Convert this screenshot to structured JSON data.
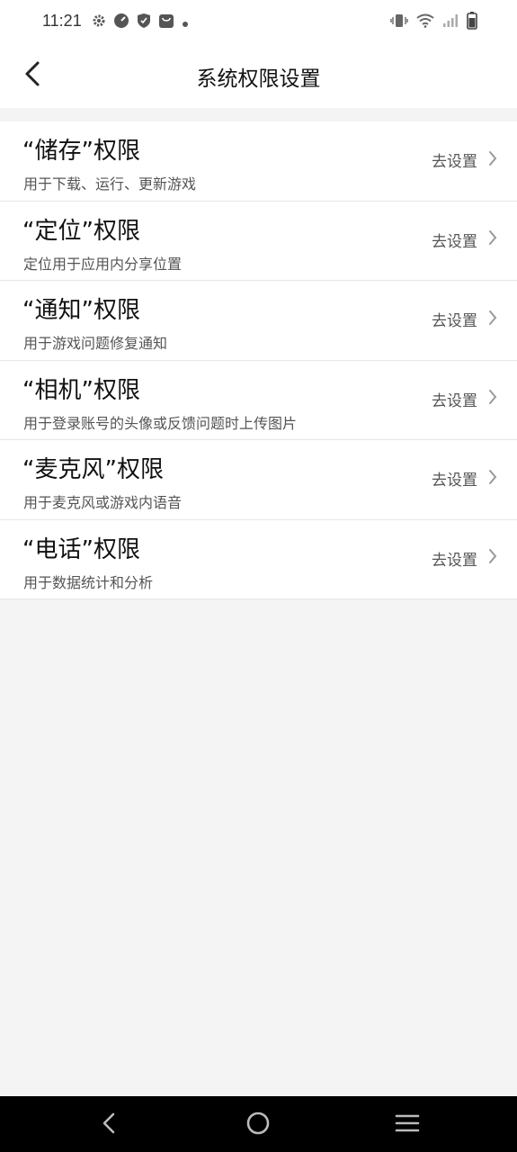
{
  "status_bar": {
    "time": "11:21",
    "left_icons": [
      "gear-icon",
      "speed-icon",
      "shield-icon",
      "bag-icon",
      "dot-icon"
    ],
    "right_icons": [
      "vibrate-icon",
      "wifi-icon",
      "signal-icon",
      "battery-icon"
    ]
  },
  "header": {
    "title": "系统权限设置",
    "back_icon": "chevron-left-icon"
  },
  "permissions": [
    {
      "title": "“储存”权限",
      "desc": "用于下载、运行、更新游戏",
      "action": "去设置"
    },
    {
      "title": "“定位”权限",
      "desc": "定位用于应用内分享位置",
      "action": "去设置"
    },
    {
      "title": "“通知”权限",
      "desc": "用于游戏问题修复通知",
      "action": "去设置"
    },
    {
      "title": "“相机”权限",
      "desc": "用于登录账号的头像或反馈问题时上传图片",
      "action": "去设置"
    },
    {
      "title": "“麦克风”权限",
      "desc": "用于麦克风或游戏内语音",
      "action": "去设置"
    },
    {
      "title": "“电话”权限",
      "desc": "用于数据统计和分析",
      "action": "去设置"
    }
  ],
  "system_nav": {
    "icons": [
      "back-triangle-icon",
      "home-circle-icon",
      "recents-menu-icon"
    ]
  },
  "colors": {
    "background": "#f4f4f4",
    "surface": "#ffffff",
    "text_primary": "#111111",
    "text_secondary": "#555555",
    "divider": "#e6e6e6",
    "system_nav": "#000000"
  }
}
